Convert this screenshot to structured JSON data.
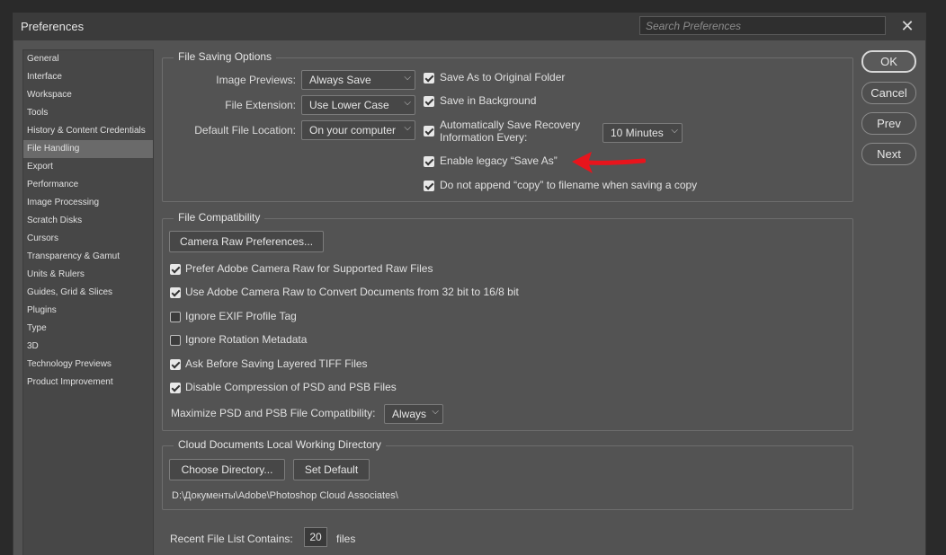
{
  "window": {
    "title": "Preferences",
    "search_placeholder": "Search Preferences",
    "close": "✕"
  },
  "sidebar": {
    "items": [
      {
        "label": "General"
      },
      {
        "label": "Interface"
      },
      {
        "label": "Workspace"
      },
      {
        "label": "Tools"
      },
      {
        "label": "History & Content Credentials"
      },
      {
        "label": "File Handling",
        "selected": true
      },
      {
        "label": "Export"
      },
      {
        "label": "Performance"
      },
      {
        "label": "Image Processing"
      },
      {
        "label": "Scratch Disks"
      },
      {
        "label": "Cursors"
      },
      {
        "label": "Transparency & Gamut"
      },
      {
        "label": "Units & Rulers"
      },
      {
        "label": "Guides, Grid & Slices"
      },
      {
        "label": "Plugins"
      },
      {
        "label": "Type"
      },
      {
        "label": "3D"
      },
      {
        "label": "Technology Previews"
      },
      {
        "label": "Product Improvement"
      }
    ]
  },
  "buttons": {
    "ok": "OK",
    "cancel": "Cancel",
    "prev": "Prev",
    "next": "Next"
  },
  "file_saving": {
    "title": "File Saving Options",
    "image_previews_label": "Image Previews:",
    "image_previews_value": "Always Save",
    "file_extension_label": "File Extension:",
    "file_extension_value": "Use Lower Case",
    "default_location_label": "Default File Location:",
    "default_location_value": "On your computer",
    "save_original_folder": "Save As to Original Folder",
    "save_background": "Save in Background",
    "auto_save_line1": "Automatically Save Recovery",
    "auto_save_line2": "Information Every:",
    "auto_save_interval": "10 Minutes",
    "legacy_save_as": "Enable legacy “Save As”",
    "no_copy_append": "Do not append “copy” to filename when saving a copy"
  },
  "file_compat": {
    "title": "File Compatibility",
    "camera_raw_button": "Camera Raw Preferences...",
    "prefer_acr": "Prefer Adobe Camera Raw for Supported Raw Files",
    "use_acr_convert": "Use Adobe Camera Raw to Convert Documents from 32 bit to 16/8 bit",
    "ignore_exif": "Ignore EXIF Profile Tag",
    "ignore_rotation": "Ignore Rotation Metadata",
    "ask_tiff": "Ask Before Saving Layered TIFF Files",
    "disable_compression": "Disable Compression of PSD and PSB Files",
    "maximize_label": "Maximize PSD and PSB File Compatibility:",
    "maximize_value": "Always"
  },
  "cloud": {
    "title": "Cloud Documents Local Working Directory",
    "choose_button": "Choose Directory...",
    "default_button": "Set Default",
    "path": "D:\\Документы\\Adobe\\Photoshop Cloud Associates\\"
  },
  "recent": {
    "label": "Recent File List Contains:",
    "value": "20",
    "unit": "files"
  },
  "colors": {
    "annotation_arrow": "#e8141c"
  }
}
